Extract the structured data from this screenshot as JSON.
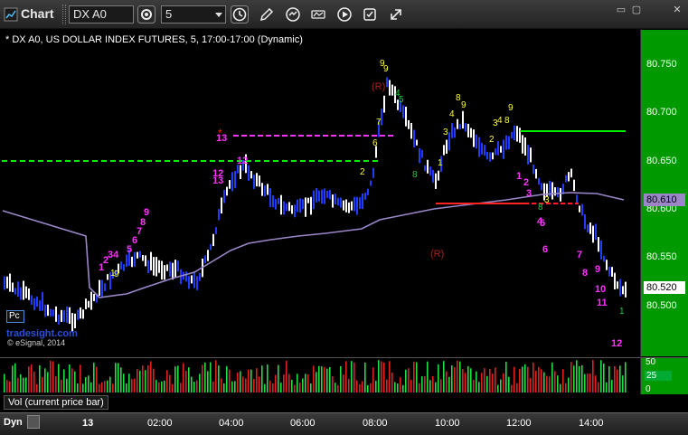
{
  "toolbar": {
    "app_title": "Chart",
    "symbol": "DX A0",
    "interval": "5",
    "icons": [
      "chart-icon",
      "settings-icon",
      "clock-icon",
      "pencil-icon",
      "refresh-icon",
      "study-icon",
      "play-icon",
      "properties-icon",
      "link-icon"
    ]
  },
  "chart": {
    "header": "* DX A0, US DOLLAR INDEX FUTURES, 5, 17:00-17:00 (Dynamic)",
    "watermark": "tradesight.com",
    "copyright": "© eSignal, 2014",
    "pc_badge": "Pc",
    "price_axis_labels": [
      "80.750",
      "80.700",
      "80.650",
      "80.600",
      "80.550",
      "80.500"
    ],
    "price_tags": [
      {
        "value": "80.610",
        "bg": "#9a86c8",
        "fg": "#000000"
      },
      {
        "value": "80.520",
        "bg": "#ffffff",
        "fg": "#000000"
      }
    ],
    "markers_r": [
      "(R)",
      "(R)"
    ],
    "setup_counts_magenta": [
      "1",
      "2",
      "34",
      "5",
      "6",
      "7",
      "8",
      "9",
      "12",
      "13",
      "12",
      "13",
      "1",
      "2",
      "3",
      "4",
      "5",
      "6",
      "7",
      "8",
      "9",
      "10",
      "11",
      "12"
    ],
    "seq_counts_yellow": [
      "9",
      "9",
      "7",
      "6",
      "3",
      "2",
      "1",
      "9",
      "8",
      "7",
      "6",
      "5",
      "4",
      "3",
      "2",
      "1",
      "9",
      "8",
      "4",
      "3",
      "2",
      "1",
      "8",
      "9"
    ],
    "colors": {
      "bar_white": "#ffffff",
      "bar_blue": "#1f3cff",
      "ma_line": "#9a86c8",
      "green_level": "#00ee00",
      "magenta_level": "#ff33ff",
      "red_level": "#ff2222",
      "axis_bg": "#009900"
    }
  },
  "volume": {
    "label": "Vol (current price bar)",
    "axis_labels": [
      "50",
      "0"
    ],
    "tag": "25"
  },
  "time_axis": {
    "dyn_label": "Dyn",
    "labels": [
      "13",
      "02:00",
      "04:00",
      "06:00",
      "08:00",
      "10:00",
      "12:00",
      "14:00"
    ]
  }
}
